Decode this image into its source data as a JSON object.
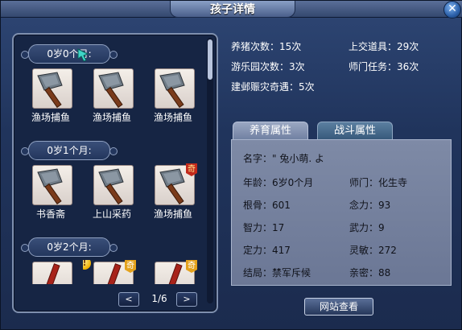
{
  "window": {
    "title": "孩子详情",
    "close_glyph": "✕"
  },
  "left": {
    "groups": [
      {
        "age": "0岁0个月:",
        "items": [
          "渔场捕鱼",
          "渔场捕鱼",
          "渔场捕鱼"
        ]
      },
      {
        "age": "0岁1个月:",
        "items": [
          "书香斋",
          "上山采药",
          "渔场捕鱼"
        ]
      },
      {
        "age": "0岁2个月:",
        "items": [
          "",
          "",
          ""
        ]
      }
    ],
    "badge_qi": "奇",
    "badge_excl": "!",
    "pager": {
      "prev": "<",
      "text": "1/6",
      "next": ">"
    }
  },
  "stats": {
    "pig": "养猪次数：15次",
    "turnin": "上交道具：29次",
    "park": "游乐园次数：3次",
    "sect": "师门任务：36次",
    "event": "建邺赈灾奇遇：5次"
  },
  "tabs": {
    "nurture": "养育属性",
    "combat": "战斗属性"
  },
  "info": {
    "name": "名字：\" 兔小萌. よ",
    "age": "年龄：6岁0个月",
    "school": "师门：化生寺",
    "root": "根骨：601",
    "mind": "念力：93",
    "intel": "智力：17",
    "force": "武力：9",
    "focus": "定力：417",
    "agility": "灵敏：272",
    "ending": "结局：禁军斥候",
    "intimacy": "亲密：88"
  },
  "buttons": {
    "website": "网站查看"
  },
  "colors": {
    "panel_bg": "#162544",
    "info_bg": "#7e8aa6",
    "badge_red": "#c22a1c"
  }
}
